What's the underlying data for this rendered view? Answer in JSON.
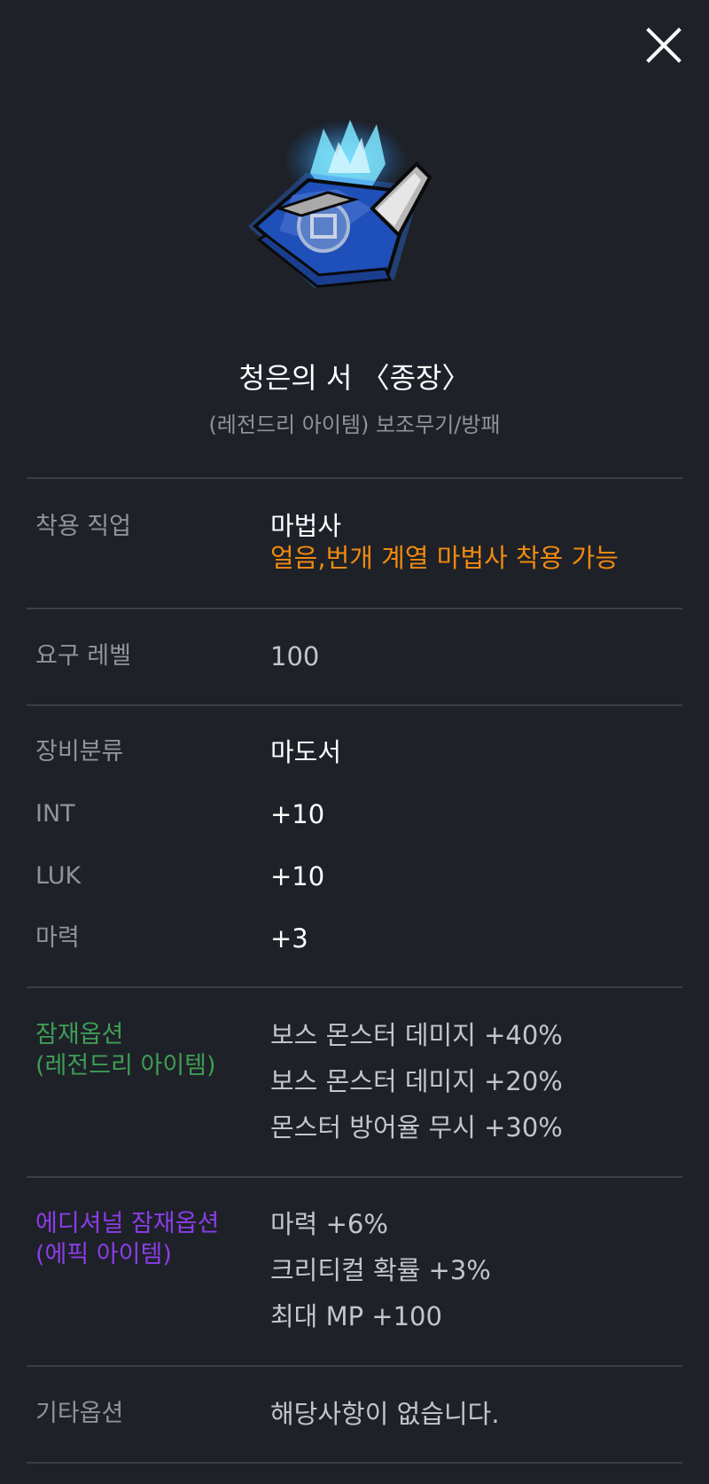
{
  "item": {
    "name": "청은의 서 〈종장〉",
    "subtitle": "(레전드리 아이템) 보조무기/방패"
  },
  "job": {
    "label": "착용 직업",
    "value": "마법사",
    "note": "얼음,번개 계열 마법사 착용 가능"
  },
  "level": {
    "label": "요구 레벨",
    "value": "100"
  },
  "stats": [
    {
      "label": "장비분류",
      "value": "마도서"
    },
    {
      "label": "INT",
      "value": "+10"
    },
    {
      "label": "LUK",
      "value": "+10"
    },
    {
      "label": "마력",
      "value": "+3"
    }
  ],
  "potential": {
    "label_line1": "잠재옵션",
    "label_line2": "(레전드리 아이템)",
    "lines": [
      "보스 몬스터 데미지 +40%",
      "보스 몬스터 데미지 +20%",
      "몬스터 방어율 무시 +30%"
    ]
  },
  "additional": {
    "label_line1": "에디셔널 잠재옵션",
    "label_line2": "(에픽 아이템)",
    "lines": [
      "마력 +6%",
      "크리티컬 확률 +3%",
      "최대 MP +100"
    ]
  },
  "etc": {
    "label": "기타옵션",
    "value": "해당사항이 없습니다."
  },
  "colors": {
    "background": "#1e2128",
    "divider": "#3b3f47",
    "label_gray": "#8f939b",
    "job_note_orange": "#f08a10",
    "legendary_green": "#3f9d55",
    "epic_purple": "#8b3de6"
  },
  "icons": {
    "close": "close-icon",
    "item": "spellbook-item-icon"
  }
}
